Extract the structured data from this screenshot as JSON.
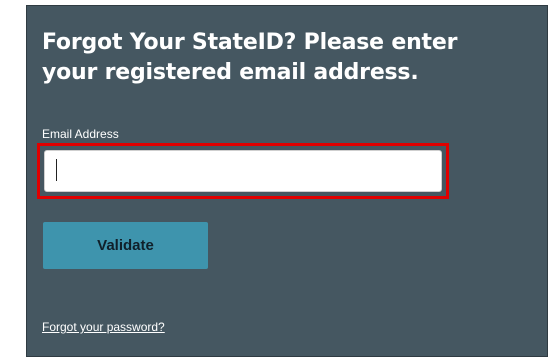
{
  "form": {
    "heading": "Forgot Your StateID? Please enter your registered email address.",
    "email_label": "Email Address",
    "email_value": "",
    "validate_label": "Validate",
    "forgot_password_link": "Forgot your password?"
  },
  "colors": {
    "panel_background": "#455761",
    "highlight_border": "#e00000",
    "button_background": "#3e94ad"
  }
}
